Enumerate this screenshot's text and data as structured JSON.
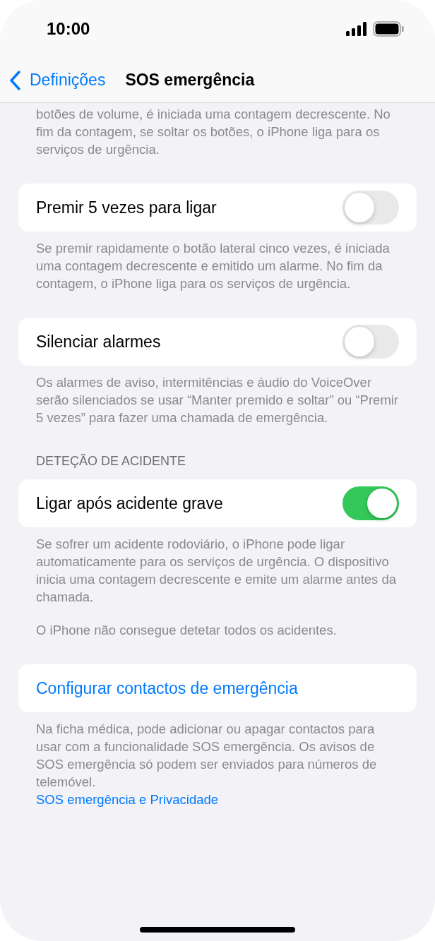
{
  "status_bar": {
    "time": "10:00"
  },
  "nav": {
    "back": "Definições",
    "title": "SOS emergência"
  },
  "sections": [
    {
      "footer": [
        {
          "kind": "text",
          "text": "botões de volume, é iniciada uma contagem decrescente. No fim da contagem, se soltar os botões, o iPhone liga para os serviços de urgência."
        }
      ]
    },
    {
      "row": {
        "kind": "toggle",
        "label": "Premir 5 vezes para ligar",
        "on": false
      },
      "footer": [
        {
          "kind": "text",
          "text": "Se premir rapidamente o botão lateral cinco vezes, é iniciada uma contagem decrescente e emitido um alarme. No fim da contagem, o iPhone liga para os serviços de urgência."
        }
      ]
    },
    {
      "row": {
        "kind": "toggle",
        "label": "Silenciar alarmes",
        "on": false
      },
      "footer": [
        {
          "kind": "text",
          "text": "Os alarmes de aviso, intermitências e áudio do VoiceOver serão silenciados se usar “Manter premido e soltar” ou “Premir 5 vezes” para fazer uma chamada de emergência."
        }
      ]
    },
    {
      "header": "DETEÇÃO DE ACIDENTE",
      "row": {
        "kind": "toggle",
        "label": "Ligar após acidente grave",
        "on": true
      },
      "footer": [
        {
          "kind": "text",
          "text": "Se sofrer um acidente rodoviário, o iPhone pode ligar automaticamente para os serviços de urgência. O dispositivo inicia uma contagem decrescente e emite um alarme antes da chamada."
        },
        {
          "kind": "text",
          "text": "O iPhone não consegue detetar todos os acidentes."
        }
      ]
    },
    {
      "row": {
        "kind": "link",
        "label": "Configurar contactos de emergência"
      },
      "footer": [
        {
          "kind": "text",
          "text": "Na ficha médica, pode adicionar ou apagar contactos para usar com a funcionalidade SOS emergência. Os avisos de SOS emergência só podem ser enviados para números de telemóvel."
        },
        {
          "kind": "link",
          "text": "SOS emergência e Privacidade"
        }
      ]
    }
  ]
}
